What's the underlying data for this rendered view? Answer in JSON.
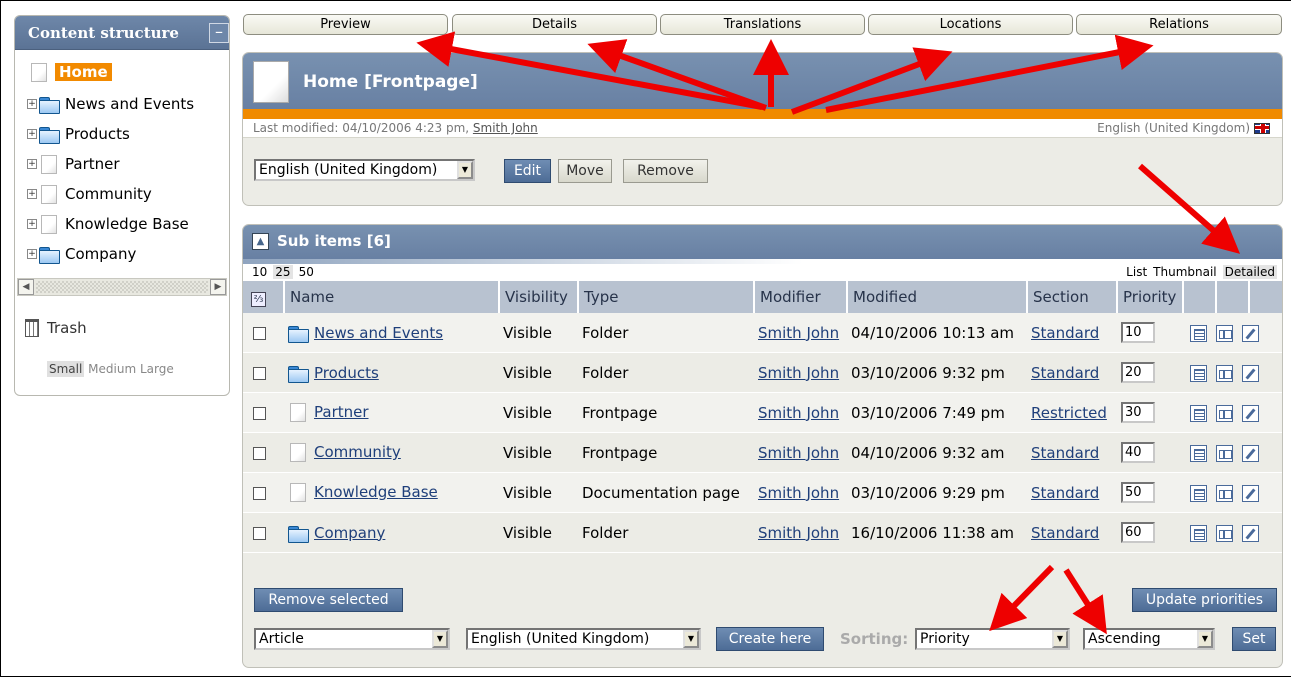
{
  "sidebar": {
    "title": "Content structure",
    "collapse": "–",
    "root": "Home",
    "items": [
      {
        "label": "News and Events",
        "icon": "folder-icon"
      },
      {
        "label": "Products",
        "icon": "folder-icon"
      },
      {
        "label": "Partner",
        "icon": "page-icon"
      },
      {
        "label": "Community",
        "icon": "page-icon"
      },
      {
        "label": "Knowledge Base",
        "icon": "page-icon"
      },
      {
        "label": "Company",
        "icon": "folder-icon"
      }
    ],
    "trash": "Trash",
    "sizes": [
      "Small",
      "Medium",
      "Large"
    ]
  },
  "tabs": [
    "Preview",
    "Details",
    "Translations",
    "Locations",
    "Relations"
  ],
  "node": {
    "title": "Home [Frontpage]",
    "modified_prefix": "Last modified: 04/10/2006 4:23 pm,",
    "modified_by": "Smith John",
    "language": "English (United Kingdom)",
    "language_select": "English (United Kingdom)",
    "buttons": {
      "edit": "Edit",
      "move": "Move",
      "remove": "Remove"
    }
  },
  "subitems": {
    "title": "Sub items [6]",
    "page_sizes": [
      "10",
      "25",
      "50"
    ],
    "views": [
      "List",
      "Thumbnail",
      "Detailed"
    ],
    "columns": {
      "toggle": "⅔",
      "name": "Name",
      "visibility": "Visibility",
      "type": "Type",
      "modifier": "Modifier",
      "modified": "Modified",
      "section": "Section",
      "priority": "Priority"
    },
    "rows": [
      {
        "name": "News and Events",
        "icon": "folder-icon",
        "visibility": "Visible",
        "type": "Folder",
        "modifier": "Smith John",
        "modified": "04/10/2006 10:13 am",
        "section": "Standard",
        "priority": "10"
      },
      {
        "name": "Products",
        "icon": "folder-icon",
        "visibility": "Visible",
        "type": "Folder",
        "modifier": "Smith John",
        "modified": "03/10/2006 9:32 pm",
        "section": "Standard",
        "priority": "20"
      },
      {
        "name": "Partner",
        "icon": "page-icon",
        "visibility": "Visible",
        "type": "Frontpage",
        "modifier": "Smith John",
        "modified": "03/10/2006 7:49 pm",
        "section": "Restricted",
        "priority": "30"
      },
      {
        "name": "Community",
        "icon": "page-icon",
        "visibility": "Visible",
        "type": "Frontpage",
        "modifier": "Smith John",
        "modified": "04/10/2006 9:32 am",
        "section": "Standard",
        "priority": "40"
      },
      {
        "name": "Knowledge Base",
        "icon": "page-icon",
        "visibility": "Visible",
        "type": "Documentation page",
        "modifier": "Smith John",
        "modified": "03/10/2006 9:29 pm",
        "section": "Standard",
        "priority": "50"
      },
      {
        "name": "Company",
        "icon": "folder-icon",
        "visibility": "Visible",
        "type": "Folder",
        "modifier": "Smith John",
        "modified": "16/10/2006 11:38 am",
        "section": "Standard",
        "priority": "60"
      }
    ],
    "remove_selected": "Remove selected",
    "update_priorities": "Update priorities",
    "class_select": "Article",
    "lang_select": "English (United Kingdom)",
    "create_here": "Create here",
    "sorting_label": "Sorting:",
    "sort_field": "Priority",
    "sort_order": "Ascending",
    "set": "Set"
  },
  "annotation_color": "#ee0000"
}
